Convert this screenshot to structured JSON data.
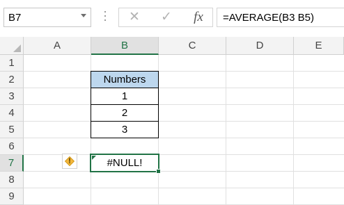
{
  "formula_bar": {
    "name_box": "B7",
    "cancel_icon": "✕",
    "enter_icon": "✓",
    "fx_label": "fx",
    "formula": "=AVERAGE(B3 B5)"
  },
  "columns": [
    "A",
    "B",
    "C",
    "D",
    "E"
  ],
  "selected_column": "B",
  "rows": [
    "1",
    "2",
    "3",
    "4",
    "5",
    "6",
    "7",
    "8",
    "9"
  ],
  "selected_row": "7",
  "cells": {
    "B2": "Numbers",
    "B3": "1",
    "B4": "2",
    "B5": "3",
    "B7": "#NULL!"
  },
  "error_indicator": {
    "icon": "warning-diamond-icon",
    "symbol": "!"
  },
  "colors": {
    "accent_green": "#217346",
    "table_header_fill": "#bdd7ee",
    "warning_orange": "#f4b73b"
  }
}
